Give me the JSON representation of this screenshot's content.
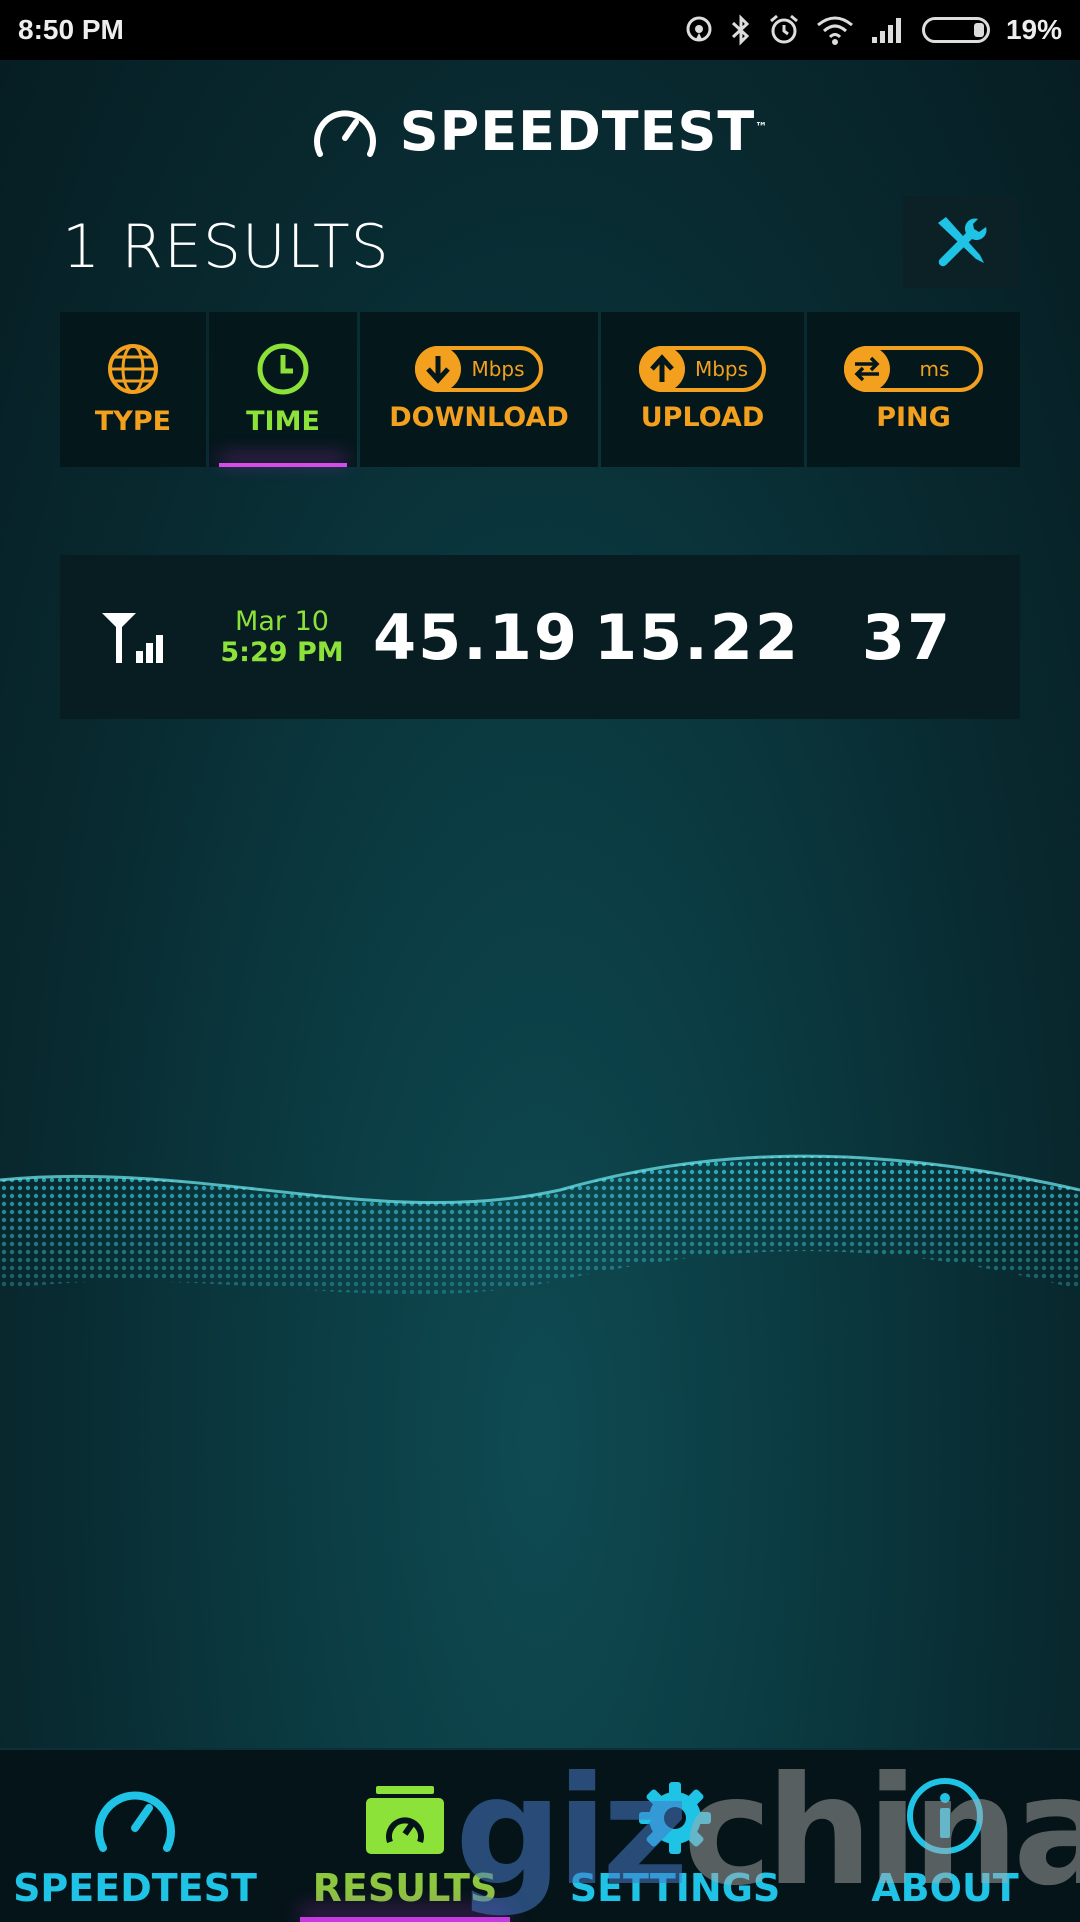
{
  "status_bar": {
    "time": "8:50 PM",
    "battery": "19%",
    "icons": [
      "hotspot-icon",
      "bluetooth-icon",
      "alarm-icon",
      "wifi-icon",
      "signal-icon",
      "battery-icon"
    ]
  },
  "header": {
    "title": "SPEEDTEST",
    "trademark": "™"
  },
  "results": {
    "count_label": "1 RESULTS"
  },
  "columns": {
    "type": "TYPE",
    "time": "TIME",
    "download": {
      "label": "DOWNLOAD",
      "unit": "Mbps"
    },
    "upload": {
      "label": "UPLOAD",
      "unit": "Mbps"
    },
    "ping": {
      "label": "PING",
      "unit": "ms"
    }
  },
  "rows": [
    {
      "connection": "cellular-icon",
      "date": "Mar 10",
      "time": "5:29 PM",
      "download": "45.19",
      "upload": "15.22",
      "ping": "37"
    }
  ],
  "nav": {
    "speedtest": "SPEEDTEST",
    "results": "RESULTS",
    "settings": "SETTINGS",
    "about": "ABOUT",
    "active": "results"
  },
  "watermark": {
    "part1": "giz",
    "part2": "china"
  },
  "colors": {
    "accent_orange": "#f2a01e",
    "accent_green": "#8de23a",
    "accent_cyan": "#1fc3e6",
    "active_underline": "#c53be0"
  }
}
